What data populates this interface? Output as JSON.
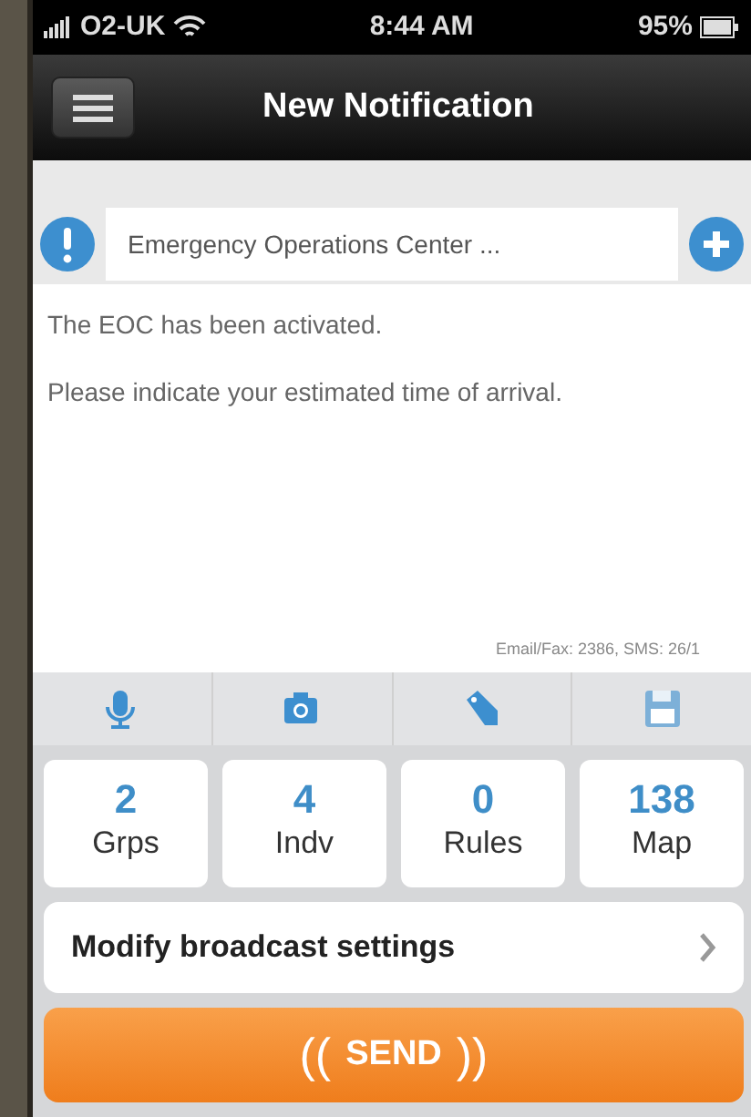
{
  "status_bar": {
    "carrier": "O2-UK",
    "time": "8:44 AM",
    "battery": "95%"
  },
  "nav_bar": {
    "title": "New Notification"
  },
  "recipient": {
    "value": "Emergency Operations Center ..."
  },
  "message": {
    "lines": [
      "The EOC has been activated.",
      "Please indicate your estimated time of arrival."
    ],
    "counter": "Email/Fax: 2386, SMS: 26/1"
  },
  "toolbar": [
    {
      "kind": "mic"
    },
    {
      "kind": "camera"
    },
    {
      "kind": "tag"
    },
    {
      "kind": "save"
    }
  ],
  "counts": [
    {
      "value": "2",
      "label": "Grps"
    },
    {
      "value": "4",
      "label": "Indv"
    },
    {
      "value": "0",
      "label": "Rules"
    },
    {
      "value": "138",
      "label": "Map"
    }
  ],
  "settings_row": {
    "label": "Modify broadcast settings"
  },
  "send_button": {
    "left_mark": "((",
    "label": "SEND",
    "right_mark": "))"
  }
}
